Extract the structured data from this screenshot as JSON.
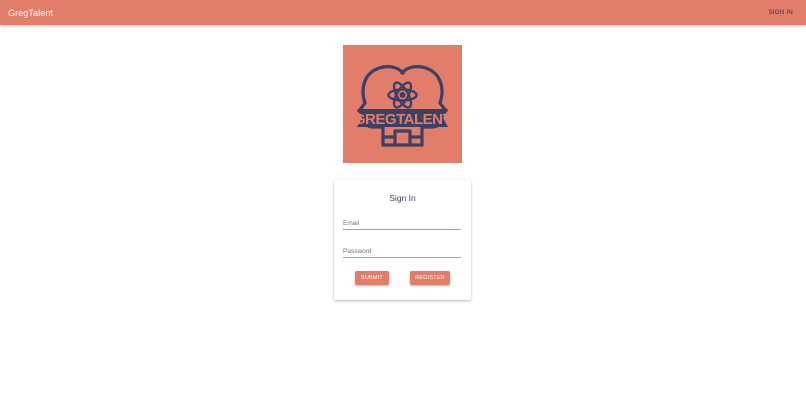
{
  "header": {
    "brand": "GregTalent",
    "signin_label": "SIGN IN",
    "background": "#e27d6a"
  },
  "logo": {
    "text": "GREGTALENT",
    "background": "#e27d6a",
    "ink": "#3c3f66"
  },
  "form": {
    "title": "Sign In",
    "email_placeholder": "Email",
    "password_placeholder": "Password",
    "submit_label": "SUBMIT",
    "register_label": "REGISTER",
    "accent": "#e27d6a"
  }
}
